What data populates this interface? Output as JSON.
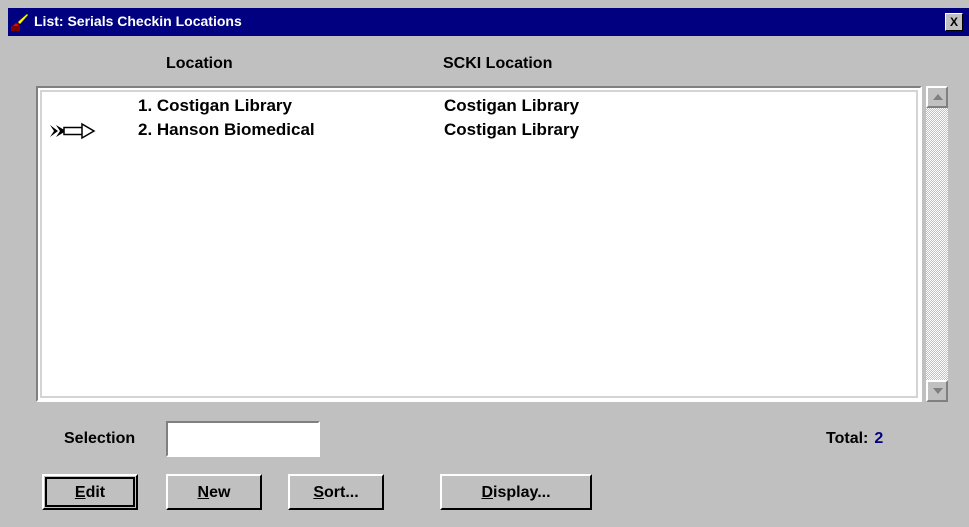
{
  "window": {
    "title": "List: Serials Checkin Locations",
    "close_label": "X"
  },
  "columns": {
    "location": "Location",
    "scki_location": "SCKI Location"
  },
  "rows": [
    {
      "location": "1. Costigan Library",
      "scki_location": "Costigan Library",
      "selected": false
    },
    {
      "location": "2. Hanson Biomedical",
      "scki_location": "Costigan Library",
      "selected": true
    }
  ],
  "selection": {
    "label": "Selection",
    "value": ""
  },
  "total": {
    "label": "Total:",
    "value": "2"
  },
  "buttons": {
    "edit": {
      "accel": "E",
      "rest": "dit"
    },
    "new": {
      "accel": "N",
      "rest": "ew"
    },
    "sort": {
      "accel": "S",
      "rest": "ort..."
    },
    "display": {
      "accel": "D",
      "rest": "isplay..."
    }
  },
  "colors": {
    "titlebar": "#000080",
    "face": "#c0c0c0",
    "total_value": "#000080"
  },
  "icons": {
    "app": "quill-pen-icon",
    "pointer": "double-arrow-pointer-icon",
    "scroll_up": "triangle-up-icon",
    "scroll_down": "triangle-down-icon"
  }
}
